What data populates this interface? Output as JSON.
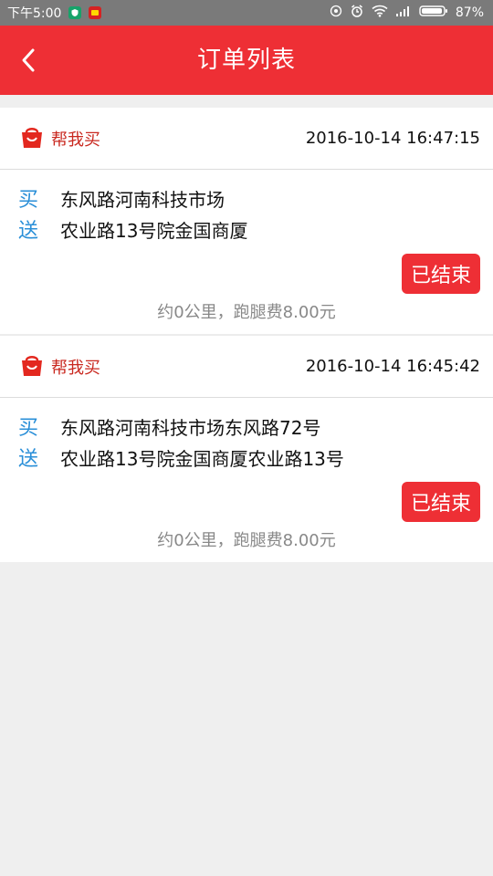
{
  "status_bar": {
    "time": "下午5:00",
    "battery": "87%"
  },
  "header": {
    "title": "订单列表"
  },
  "orders": [
    {
      "service_type": "帮我买",
      "time": "2016-10-14 16:47:15",
      "buy_label": "买",
      "buy_address": "东风路河南科技市场",
      "deliver_label": "送",
      "deliver_address": "农业路13号院金国商厦",
      "status": "已结束",
      "fee": "约0公里，跑腿费8.00元"
    },
    {
      "service_type": "帮我买",
      "time": "2016-10-14 16:45:42",
      "buy_label": "买",
      "buy_address": "东风路河南科技市场东风路72号",
      "deliver_label": "送",
      "deliver_address": "农业路13号院金国商厦农业路13号",
      "status": "已结束",
      "fee": "约0公里，跑腿费8.00元"
    }
  ],
  "colors": {
    "accent": "#ee2f35",
    "service_text": "#c9281f",
    "address_label": "#2a8fd8"
  }
}
